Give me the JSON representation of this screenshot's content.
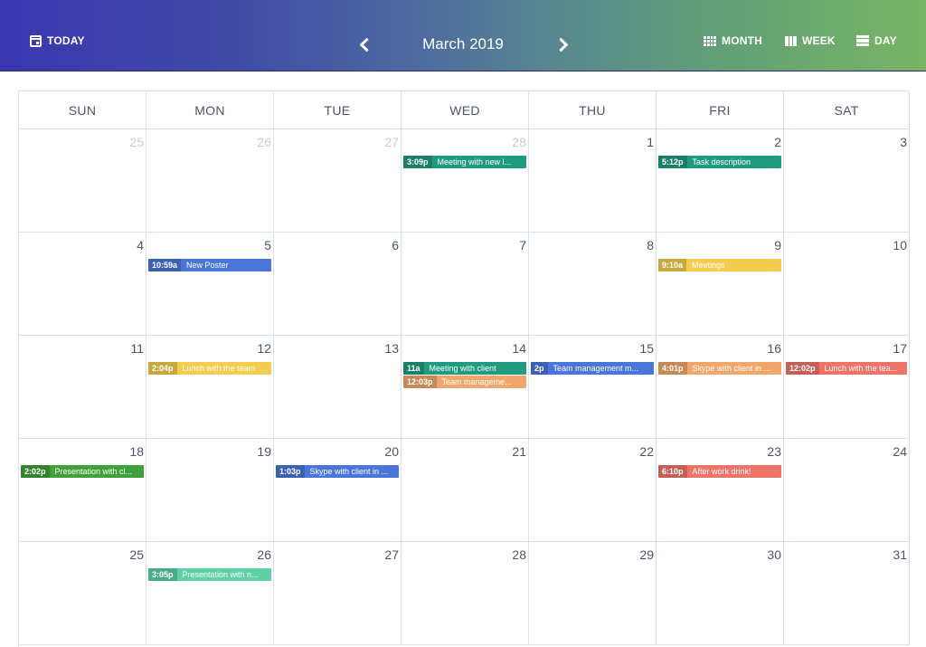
{
  "header": {
    "today_label": "TODAY",
    "title": "March 2019",
    "month_label": "MONTH",
    "week_label": "WEEK",
    "day_label": "DAY"
  },
  "weekdays": [
    "SUN",
    "MON",
    "TUE",
    "WED",
    "THU",
    "FRI",
    "SAT"
  ],
  "weeks": [
    [
      {
        "day": "25",
        "muted": true,
        "events": []
      },
      {
        "day": "26",
        "muted": true,
        "events": []
      },
      {
        "day": "27",
        "muted": true,
        "events": []
      },
      {
        "day": "28",
        "muted": true,
        "events": [
          {
            "time": "3:09p",
            "title": "Meeting with new l...",
            "color": "#1f9b80"
          }
        ]
      },
      {
        "day": "1",
        "muted": false,
        "events": []
      },
      {
        "day": "2",
        "muted": false,
        "events": [
          {
            "time": "5:12p",
            "title": "Task description",
            "color": "#1f9b80"
          }
        ]
      },
      {
        "day": "3",
        "muted": false,
        "events": []
      }
    ],
    [
      {
        "day": "4",
        "muted": false,
        "events": []
      },
      {
        "day": "5",
        "muted": false,
        "events": [
          {
            "time": "10:59a",
            "title": "New Poster",
            "color": "#4a76d9"
          }
        ]
      },
      {
        "day": "6",
        "muted": false,
        "events": []
      },
      {
        "day": "7",
        "muted": false,
        "events": []
      },
      {
        "day": "8",
        "muted": false,
        "events": []
      },
      {
        "day": "9",
        "muted": false,
        "events": [
          {
            "time": "9:10a",
            "title": "Meetings",
            "color": "#f4cc4e"
          }
        ]
      },
      {
        "day": "10",
        "muted": false,
        "events": []
      }
    ],
    [
      {
        "day": "11",
        "muted": false,
        "events": []
      },
      {
        "day": "12",
        "muted": false,
        "events": [
          {
            "time": "2:04p",
            "title": "Lunch with the team",
            "color": "#f4cc4e"
          }
        ]
      },
      {
        "day": "13",
        "muted": false,
        "events": []
      },
      {
        "day": "14",
        "muted": false,
        "events": [
          {
            "time": "11a",
            "title": "Meeting with client",
            "color": "#1f9b80"
          },
          {
            "time": "12:03p",
            "title": "Team manageme...",
            "color": "#f1a76b"
          }
        ]
      },
      {
        "day": "15",
        "muted": false,
        "events": [
          {
            "time": "2p",
            "title": "Team management m...",
            "color": "#4a76d9"
          }
        ]
      },
      {
        "day": "16",
        "muted": false,
        "events": [
          {
            "time": "4:01p",
            "title": "Skype with client in ...",
            "color": "#f1a76b"
          }
        ]
      },
      {
        "day": "17",
        "muted": false,
        "events": [
          {
            "time": "12:02p",
            "title": "Lunch with the tea...",
            "color": "#ee7468"
          }
        ]
      }
    ],
    [
      {
        "day": "18",
        "muted": false,
        "events": [
          {
            "time": "2:02p",
            "title": "Presentation with cl...",
            "color": "#3fa13a"
          }
        ]
      },
      {
        "day": "19",
        "muted": false,
        "events": []
      },
      {
        "day": "20",
        "muted": false,
        "events": [
          {
            "time": "1:03p",
            "title": "Skype with client in ...",
            "color": "#4a76d9"
          }
        ]
      },
      {
        "day": "21",
        "muted": false,
        "events": []
      },
      {
        "day": "22",
        "muted": false,
        "events": []
      },
      {
        "day": "23",
        "muted": false,
        "events": [
          {
            "time": "6:10p",
            "title": "After work drink!",
            "color": "#ee7468"
          }
        ]
      },
      {
        "day": "24",
        "muted": false,
        "events": []
      }
    ],
    [
      {
        "day": "25",
        "muted": false,
        "events": []
      },
      {
        "day": "26",
        "muted": false,
        "events": [
          {
            "time": "3:05p",
            "title": "Presentation with n...",
            "color": "#5fd1a6"
          }
        ]
      },
      {
        "day": "27",
        "muted": false,
        "events": []
      },
      {
        "day": "28",
        "muted": false,
        "events": []
      },
      {
        "day": "29",
        "muted": false,
        "events": []
      },
      {
        "day": "30",
        "muted": false,
        "events": []
      },
      {
        "day": "31",
        "muted": false,
        "events": []
      }
    ]
  ]
}
